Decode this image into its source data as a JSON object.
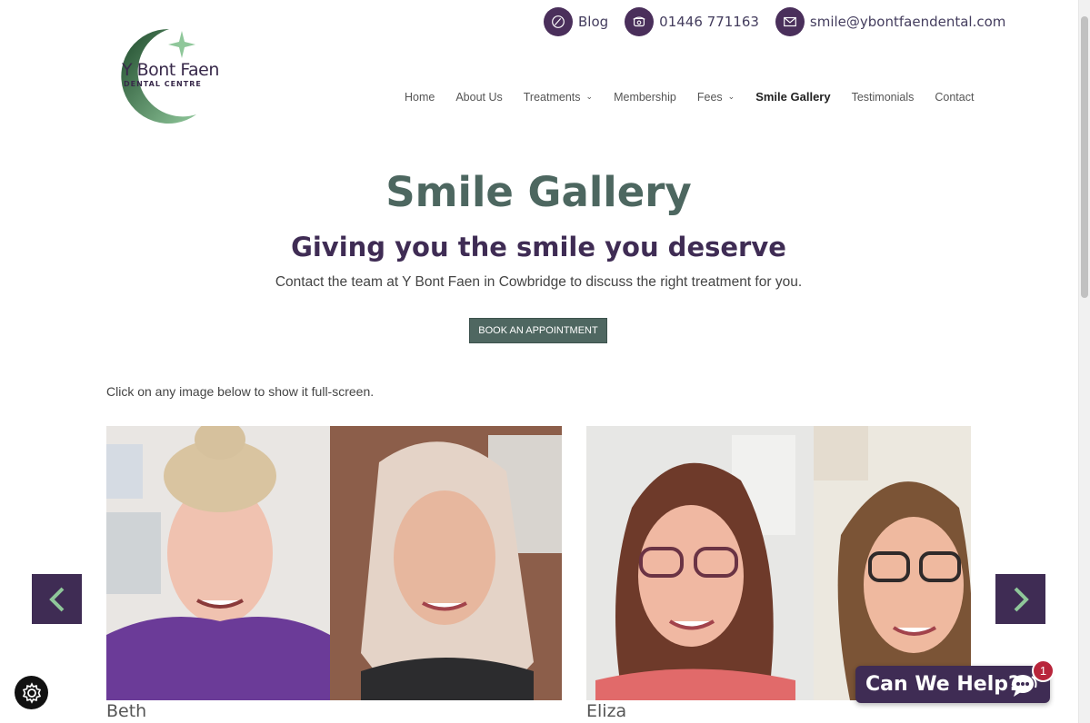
{
  "topbar": {
    "blog_label": "Blog",
    "phone_label": "01446 771163",
    "email_label": "smile@ybontfaendental.com"
  },
  "logo": {
    "name": "Y Bont Faen",
    "sub": "DENTAL CENTRE"
  },
  "nav": {
    "items": [
      {
        "label": "Home"
      },
      {
        "label": "About Us"
      },
      {
        "label": "Treatments"
      },
      {
        "label": "Membership"
      },
      {
        "label": "Fees"
      },
      {
        "label": "Smile Gallery"
      },
      {
        "label": "Testimonials"
      },
      {
        "label": "Contact"
      }
    ]
  },
  "hero": {
    "title": "Smile Gallery",
    "subtitle": "Giving you the smile you deserve",
    "lead": "Contact the team at Y Bont Faen in Cowbridge to discuss the right treatment for you.",
    "button": "BOOK AN APPOINTMENT"
  },
  "gallery": {
    "hint": "Click on any image below to show it full-screen.",
    "items": [
      {
        "caption": "Beth"
      },
      {
        "caption": "Eliza"
      }
    ]
  },
  "chat": {
    "label": "Can We Help?",
    "badge": "1"
  },
  "colors": {
    "brand_purple": "#3f2c54",
    "brand_green": "#4f6761",
    "badge_red": "#b8253b"
  }
}
